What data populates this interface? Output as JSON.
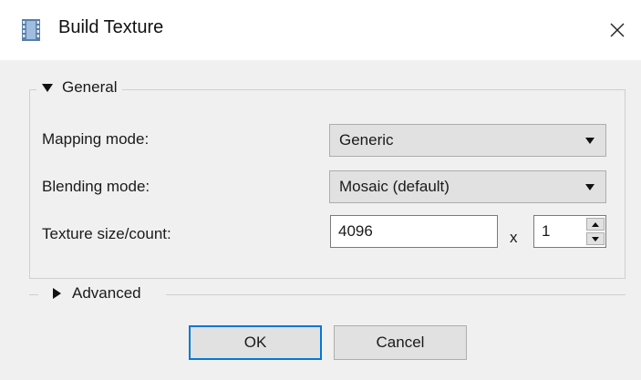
{
  "window": {
    "title": "Build Texture",
    "icon": "film-strip-icon",
    "close_icon": "close-icon"
  },
  "general": {
    "label": "General",
    "expanded": true,
    "mapping_mode": {
      "label": "Mapping mode:",
      "value": "Generic"
    },
    "blending_mode": {
      "label": "Blending mode:",
      "value": "Mosaic (default)"
    },
    "texture_size": {
      "label": "Texture size/count:",
      "size_value": "4096",
      "separator": "x",
      "count_value": "1"
    }
  },
  "advanced": {
    "label": "Advanced",
    "expanded": false
  },
  "buttons": {
    "ok_label": "OK",
    "cancel_label": "Cancel"
  },
  "colors": {
    "accent": "#0078d7",
    "background": "#f0f0f0",
    "title_bar": "#ffffff"
  }
}
